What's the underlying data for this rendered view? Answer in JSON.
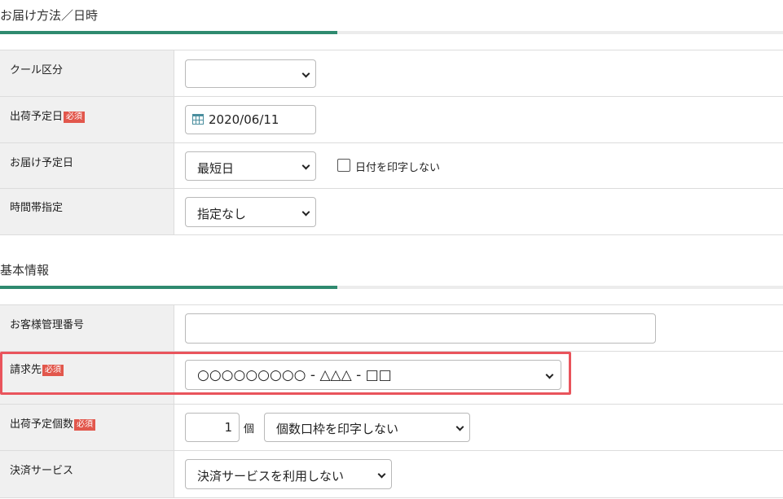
{
  "delivery": {
    "title": "お届け方法／日時",
    "cool": {
      "label": "クール区分",
      "value": ""
    },
    "ship_date": {
      "label": "出荷予定日",
      "badge": "必須",
      "value": "2020/06/11"
    },
    "delivery_date": {
      "label": "お届け予定日",
      "value": "最短日",
      "checkbox_label": "日付を印字しない"
    },
    "time_slot": {
      "label": "時間帯指定",
      "value": "指定なし"
    }
  },
  "basic": {
    "title": "基本情報",
    "customer_no": {
      "label": "お客様管理番号",
      "value": ""
    },
    "billing": {
      "label": "請求先",
      "badge": "必須",
      "value": "○○○○○○○○○ - △△△ - □□"
    },
    "count": {
      "label": "出荷予定個数",
      "badge": "必須",
      "value": "1",
      "unit": "個",
      "print_option": "個数口枠を印字しない"
    },
    "payment": {
      "label": "決済サービス",
      "value": "決済サービスを利用しない"
    }
  },
  "colors": {
    "accent": "#2f8a6f",
    "badge": "#e2574c",
    "highlight": "#e9545c"
  }
}
